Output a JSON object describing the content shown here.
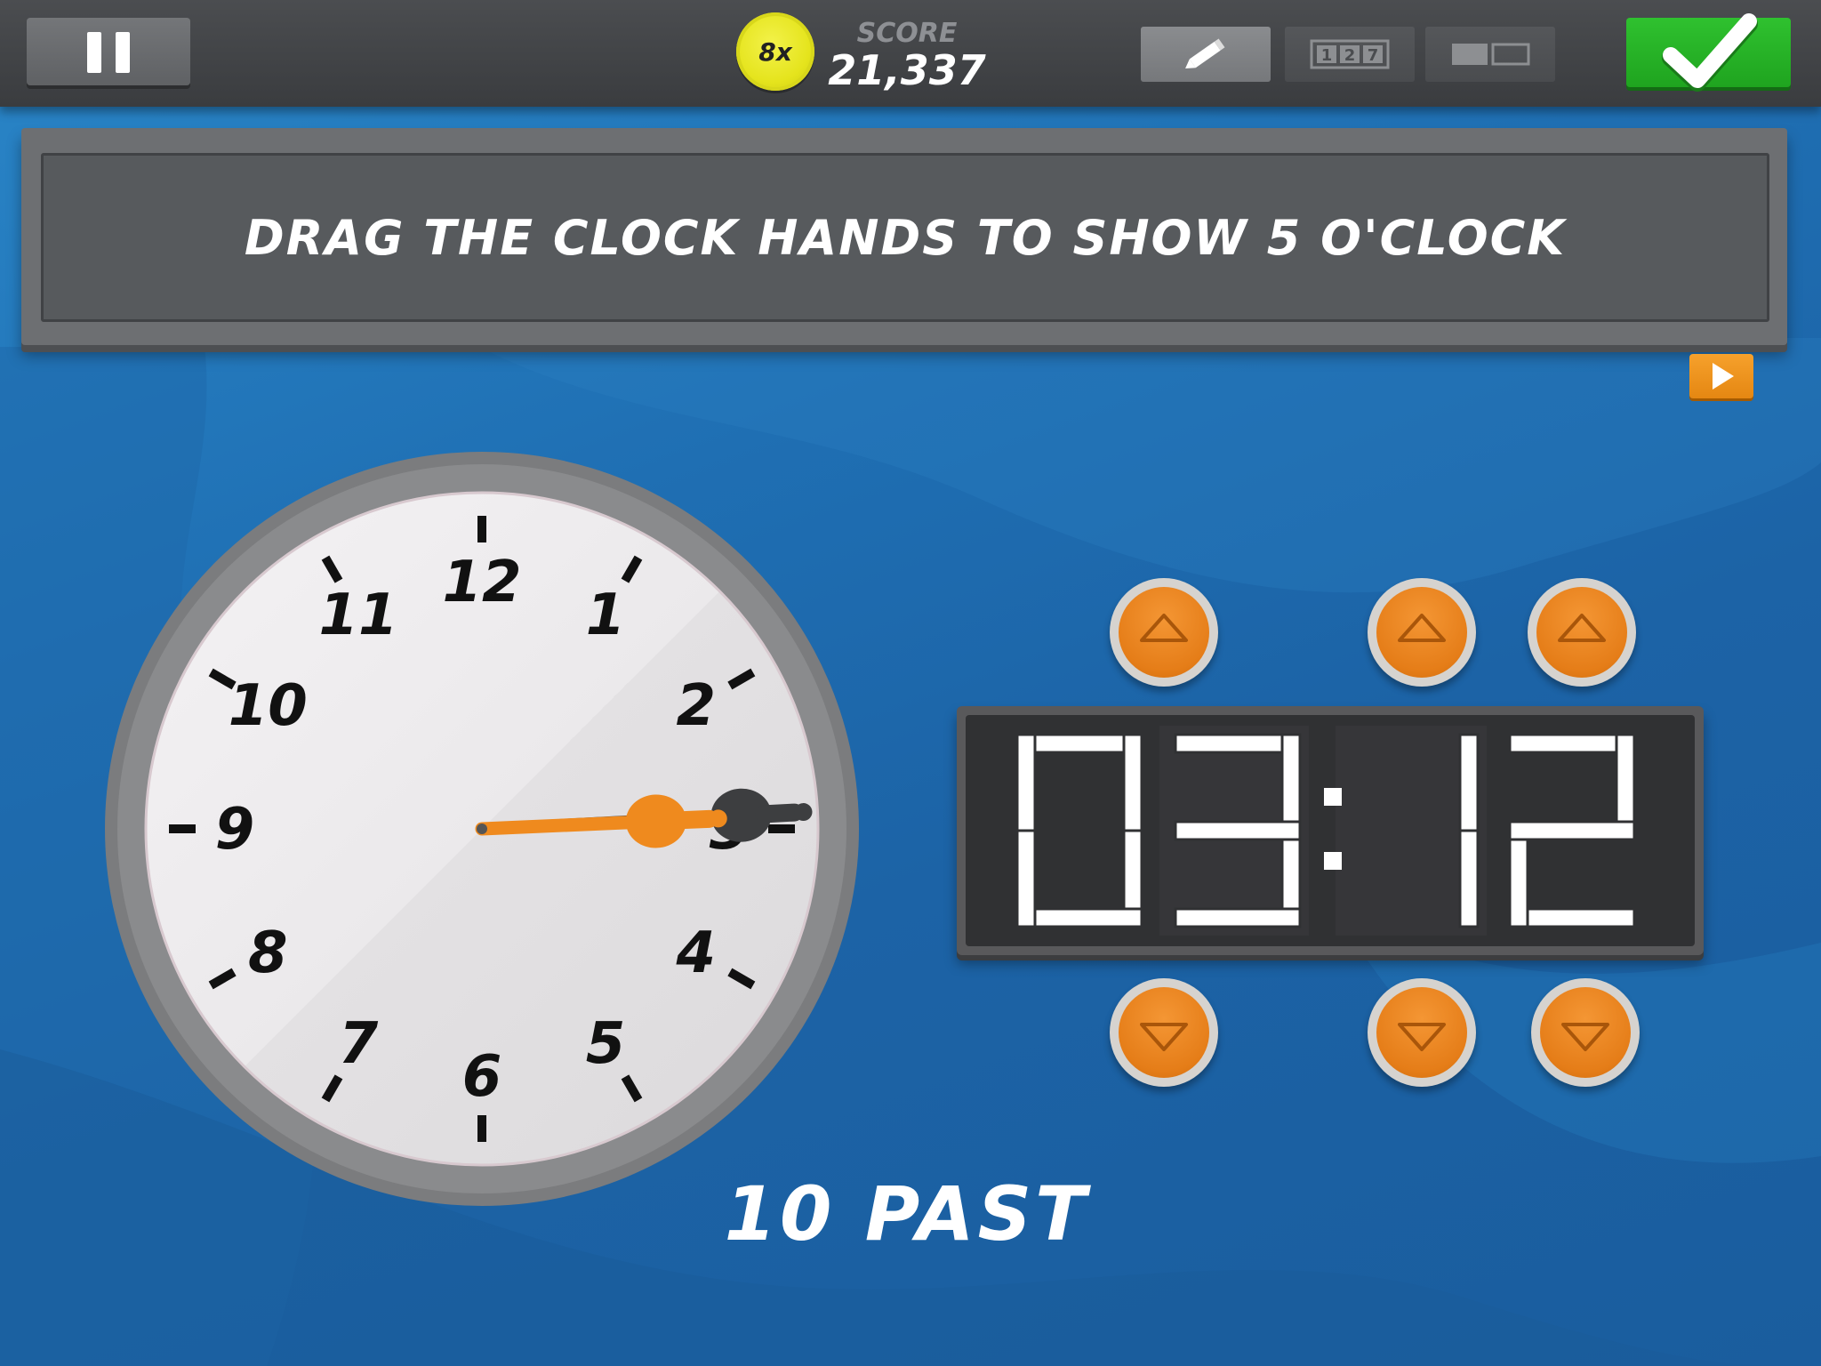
{
  "header": {
    "multiplier": "8x",
    "score_label": "SCORE",
    "score_value": "21,337"
  },
  "instruction": "DRAG THE CLOCK HANDS TO SHOW 5 O'CLOCK",
  "clock": {
    "numbers": [
      "12",
      "1",
      "2",
      "3",
      "4",
      "5",
      "6",
      "7",
      "8",
      "9",
      "10",
      "11"
    ],
    "hour_hand_value": 2.25,
    "minute_hand_value": 14.5,
    "caption": "10 PAST"
  },
  "digital": {
    "d1": "0",
    "d2": "3",
    "separator": ":",
    "d3": "1",
    "d4": "2"
  },
  "colors": {
    "accent_orange": "#ef8a1e",
    "confirm_green": "#26b226",
    "hand_dark": "#3d3e40"
  },
  "icons": {
    "pause": "pause-icon",
    "pencil": "pencil-icon",
    "numbers": "numbers-icon",
    "split": "split-view-icon",
    "check": "check-icon",
    "play": "play-icon"
  }
}
